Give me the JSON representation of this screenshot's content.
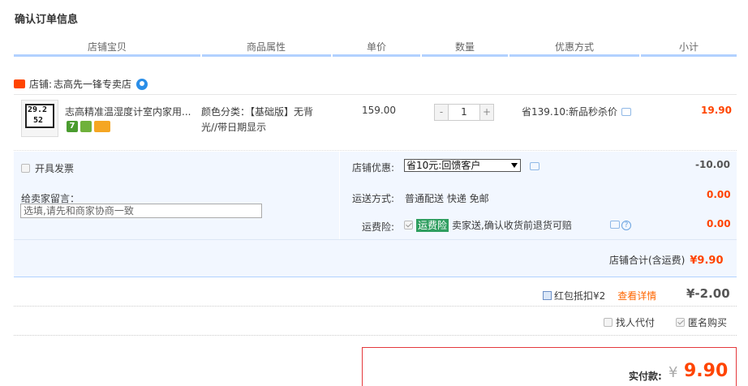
{
  "page": {
    "title": "确认订单信息"
  },
  "columns": [
    "店铺宝贝",
    "商品属性",
    "单价",
    "数量",
    "优惠方式",
    "小计"
  ],
  "shop": {
    "label": "店铺:",
    "name": "志高先一锋专卖店",
    "badge": "天猫"
  },
  "item": {
    "title": "志高精准温湿度计室内家用...",
    "attr": "颜色分类：【基础版】无背光//带日期显示",
    "price": "159.00",
    "quantity": "1",
    "minus": "-",
    "plus": "+",
    "promo": "省139.10:新品秒杀价",
    "subtotal": "19.90"
  },
  "panel": {
    "invoice_label": "开具发票",
    "memo_label": "给卖家留言：",
    "memo_placeholder": "选填,请先和商家协商一致",
    "shop_discount_label": "店铺优惠:",
    "shop_discount_option": "省10元:回馈客户",
    "shop_discount_value": "-10.00",
    "shipping_label": "运送方式:",
    "shipping_value": "普通配送 快递 免邮",
    "shipping_amount": "0.00",
    "insurance_label": "运费险:",
    "insurance_tag": "运费险",
    "insurance_desc": "卖家送,确认收货前退货可赔",
    "insurance_amount": "0.00",
    "shop_total_label": "店铺合计(含运费)",
    "shop_total_value": "¥9.90"
  },
  "redpacket": {
    "label": "红包抵扣¥2",
    "detail": "查看详情",
    "amount": "¥-2.00"
  },
  "helpers": {
    "proxy_label": "找人代付",
    "anonymous_label": "匿名购买"
  },
  "payment": {
    "label": "实付款:",
    "yen": "¥",
    "amount": "9.90"
  }
}
